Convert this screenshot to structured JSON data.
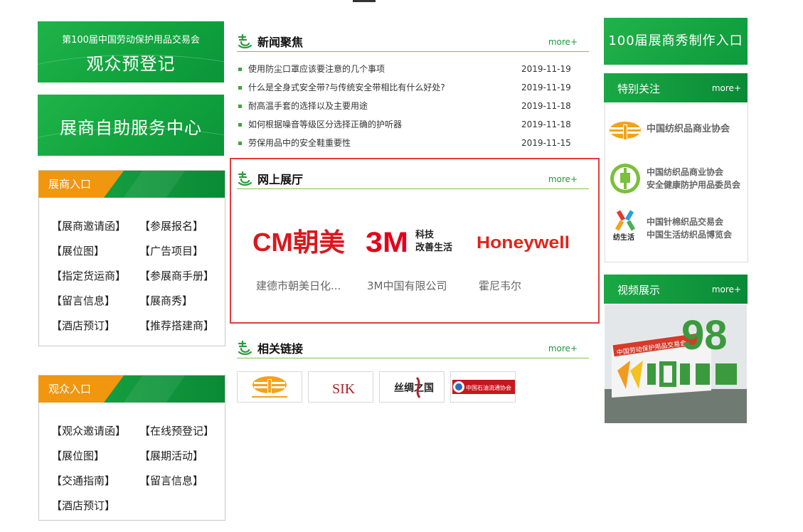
{
  "left": {
    "banner1": {
      "subtitle": "第100届中国劳动保护用品交易会",
      "title": "观众预登记"
    },
    "banner2": {
      "title": "展商自助服务中心"
    },
    "exhibitor": {
      "heading": "展商入口",
      "links": [
        "【展商邀请函】",
        "【参展报名】",
        "【展位图】",
        "【广告项目】",
        "【指定货运商】",
        "【参展商手册】",
        "【留言信息】",
        "【展商秀】",
        "【酒店预订】",
        "【推荐搭建商】"
      ]
    },
    "visitor": {
      "heading": "观众入口",
      "links": [
        "【观众邀请函】",
        "【在线预登记】",
        "【展位图】",
        "【展期活动】",
        "【交通指南】",
        "【留言信息】",
        "【酒店预订】"
      ]
    }
  },
  "center": {
    "news": {
      "title": "新闻聚焦",
      "more": "more+",
      "items": [
        {
          "title": "使用防尘口罩应该要注意的几个事项",
          "date": "2019-11-19"
        },
        {
          "title": "什么是全身式安全带?与传统安全带相比有什么好处?",
          "date": "2019-11-19"
        },
        {
          "title": "耐高温手套的选择以及主要用途",
          "date": "2019-11-18"
        },
        {
          "title": "如何根据噪音等级区分选择正确的护听器",
          "date": "2019-11-18"
        },
        {
          "title": "劳保用品中的安全鞋重要性",
          "date": "2019-11-15"
        }
      ]
    },
    "showroom": {
      "title": "网上展厅",
      "more": "more+",
      "logos": {
        "cm": "CM朝美",
        "threem": "3M",
        "threem_tag1": "科技",
        "threem_tag2": "改善生活",
        "honeywell": "Honeywell"
      },
      "names": [
        "建德市朝美日化...",
        "3M中国有限公司",
        "霍尼韦尔"
      ]
    },
    "links": {
      "title": "相关链接",
      "more": "more+",
      "logos": [
        "中国纺织品商业协会",
        "SIK",
        "丝绸之国",
        "中国石油流通协会"
      ]
    }
  },
  "right": {
    "promo": "100届展商秀制作入口",
    "focus": {
      "title": "特别关注",
      "more": "more+",
      "partners": [
        {
          "lines": [
            "中国纺织品商业协会"
          ]
        },
        {
          "lines": [
            "中国纺织品商业协会",
            "安全健康防护用品委员会"
          ]
        },
        {
          "lines": [
            "中国针棉织品交易会",
            "中国生活纺织品博览会"
          ],
          "logo_text": "纺生活"
        }
      ]
    },
    "video": {
      "title": "视频展示",
      "more": "more+",
      "sign_text": "中国劳动保护用品交易会",
      "big_number": "98"
    }
  },
  "colors": {
    "green": "#11a43d",
    "orange": "#f0960f",
    "highlight": "#e33c3c"
  }
}
